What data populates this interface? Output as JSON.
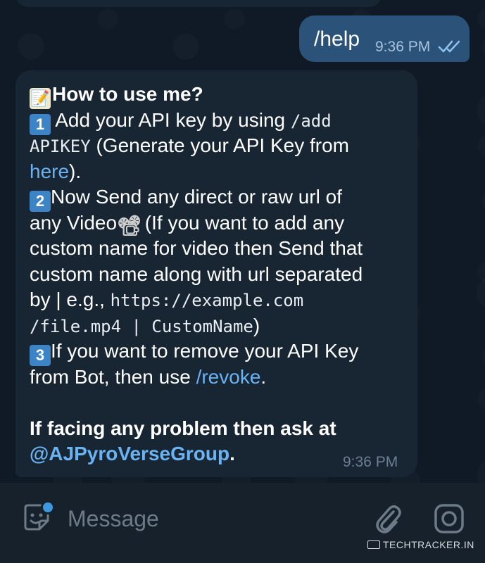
{
  "outgoing": {
    "text": "/help",
    "time": "9:36 PM",
    "status_icon": "double-check-icon"
  },
  "incoming": {
    "lines": {
      "l1_emoji": "📝",
      "l1_text": "How to use me?",
      "l2_num": "1",
      "l2_text": " Add your API key by using ",
      "l2_cmd": "/add",
      "l3_cmd": "APIKEY",
      "l3_text": " (Generate your API Key from",
      "l4_link": "here",
      "l4_text": ").",
      "l5_num": "2",
      "l5_text": "Now Send any direct or raw url of",
      "l6_text": "any Video",
      "l6_emoji": "📽",
      "l6_text2": " (If you want to add any",
      "l7_text": "custom name for video then Send that",
      "l8_text": "custom name along with url separated",
      "l9_text": "by | e.g., ",
      "l9_code": "https://example.com",
      "l10_code": "/file.mp4 | CustomName",
      "l10_text": ")",
      "l11_num": "3",
      "l11_text": "If you want to remove your API Key",
      "l12_text": "from Bot, then use ",
      "l12_link": "/revoke",
      "l12_text2": ".",
      "l14_text": "If facing any problem then ask at",
      "l15_link": "@AJPyroVerseGroup",
      "l15_text": "."
    },
    "time": "9:36 PM"
  },
  "input": {
    "placeholder": "Message",
    "left_icon": "sticker-icon",
    "right_icons": [
      "attach-icon",
      "camera-icon"
    ]
  },
  "watermark": "TECHTRACKER.IN",
  "colors": {
    "background": "#0e1621",
    "incoming_bubble": "#182533",
    "outgoing_bubble": "#2b5278",
    "link": "#6ab3f3",
    "input_bar": "#17212b"
  }
}
